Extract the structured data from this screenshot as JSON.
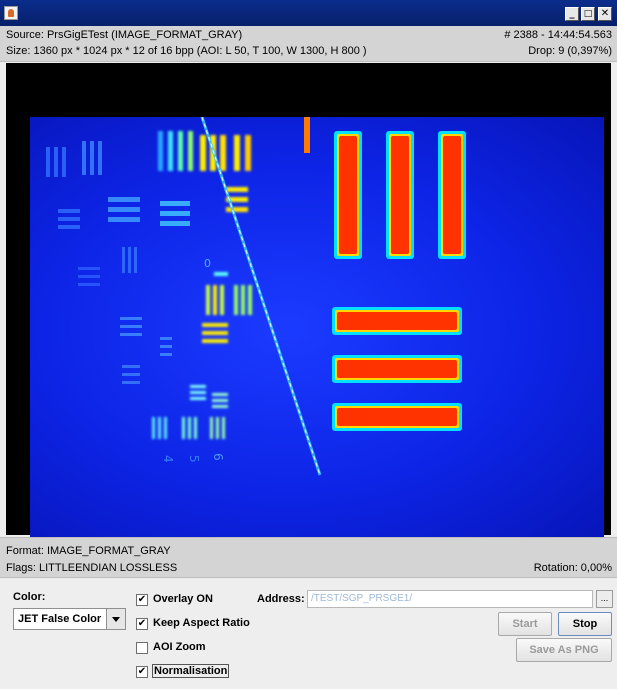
{
  "header": {
    "source": "Source: PrsGigETest (IMAGE_FORMAT_GRAY)",
    "size": "Size: 1360 px * 1024 px * 12 of 16 bpp   (AOI: L 50, T 100, W 1300, H 800 )",
    "frame": "# 2388 - 14:44:54.563",
    "drop": "Drop: 9 (0,397%)"
  },
  "window_buttons": {
    "minimize": "_",
    "maximize": "□",
    "close": "✕"
  },
  "footer": {
    "format": "Format: IMAGE_FORMAT_GRAY",
    "flags": "Flags: LITTLEENDIAN LOSSLESS",
    "rotation": "Rotation: 0,00%"
  },
  "controls": {
    "color_label": "Color:",
    "color_value": "JET False Color",
    "overlay": {
      "label": "Overlay ON",
      "checked": true
    },
    "keep_aspect": {
      "label": "Keep Aspect Ratio",
      "checked": true
    },
    "aoi_zoom": {
      "label": "AOI Zoom",
      "checked": false
    },
    "normalisation": {
      "label": "Normalisation",
      "checked": true
    },
    "address_label": "Address:",
    "address_value": "/TEST/SGP_PRSGE1/",
    "browse_label": "...",
    "start_label": "Start",
    "stop_label": "Stop",
    "save_label": "Save As PNG"
  },
  "colors": {
    "titlebar": "#0b2d8c",
    "frame_background": "#0d24e6",
    "bar_hot": "#ff3300",
    "edge_cyan": "#00e8ff",
    "mid_yellow": "#ffee00"
  },
  "camera_image": {
    "subject": "resolution test target",
    "colormap": "JET false color"
  }
}
